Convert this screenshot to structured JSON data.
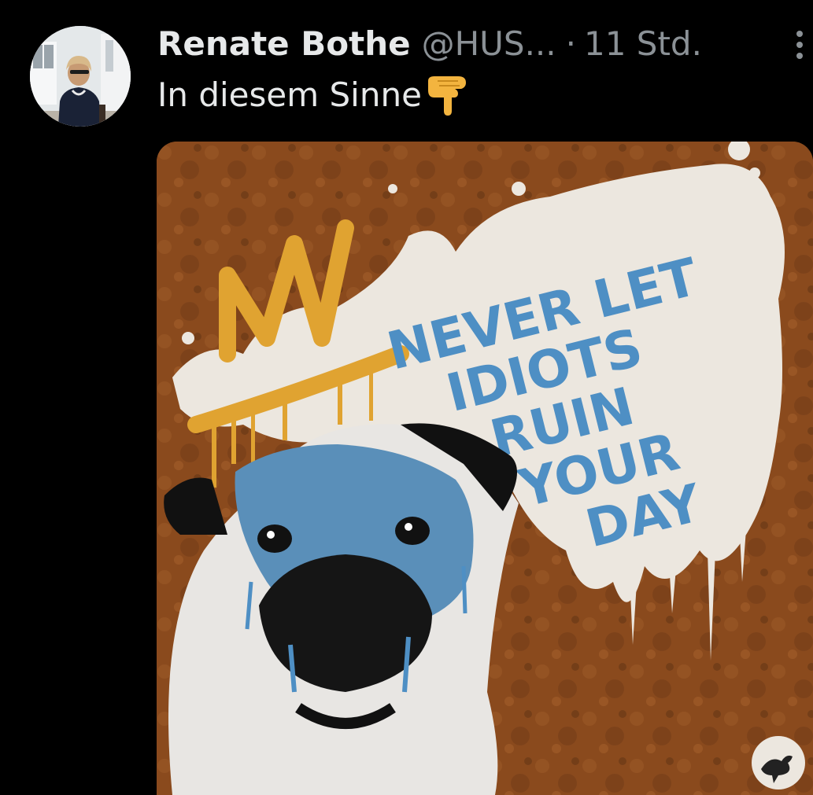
{
  "tweet": {
    "display_name": "Renate Bothe",
    "handle": "@HUS...",
    "separator": "·",
    "timestamp": "11 Std.",
    "text": "In diesem Sinne",
    "emoji": "backhand-index-pointing-down",
    "more_icon": "vertical-ellipsis-icon",
    "image": {
      "sign_lines": [
        "NEVER LET",
        "IDIOTS",
        "RUIN",
        "YOUR",
        "DAY"
      ],
      "graffiti_tag": "AM",
      "colors": {
        "rust_background": "#8a4a1d",
        "paint_white": "#ece7df",
        "paint_blue": "#4e8fc4",
        "paint_yellow": "#e0a331"
      }
    }
  },
  "colors": {
    "background": "#000000",
    "primary_text": "#e7e9ea",
    "secondary_text": "#8b9196"
  }
}
